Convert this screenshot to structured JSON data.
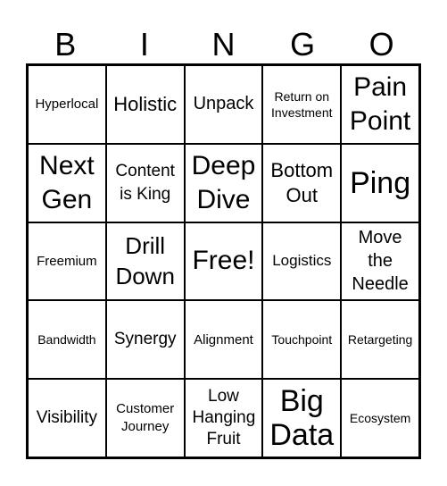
{
  "header": {
    "letters": [
      "B",
      "I",
      "N",
      "G",
      "O"
    ]
  },
  "card": {
    "rows": [
      [
        "Hyperlocal",
        "Holistic",
        "Unpack",
        "Return on Investment",
        "Pain Point"
      ],
      [
        "Next Gen",
        "Content is King",
        "Deep Dive",
        "Bottom Out",
        "Ping"
      ],
      [
        "Freemium",
        "Drill Down",
        "Free!",
        "Logistics",
        "Move the Needle"
      ],
      [
        "Bandwidth",
        "Synergy",
        "Alignment",
        "Touchpoint",
        "Retargeting"
      ],
      [
        "Visibility",
        "Customer Journey",
        "Low Hanging Fruit",
        "Big Data",
        "Ecosystem"
      ]
    ]
  },
  "colors": {
    "border": "#000000",
    "background": "#ffffff",
    "text": "#000000"
  }
}
